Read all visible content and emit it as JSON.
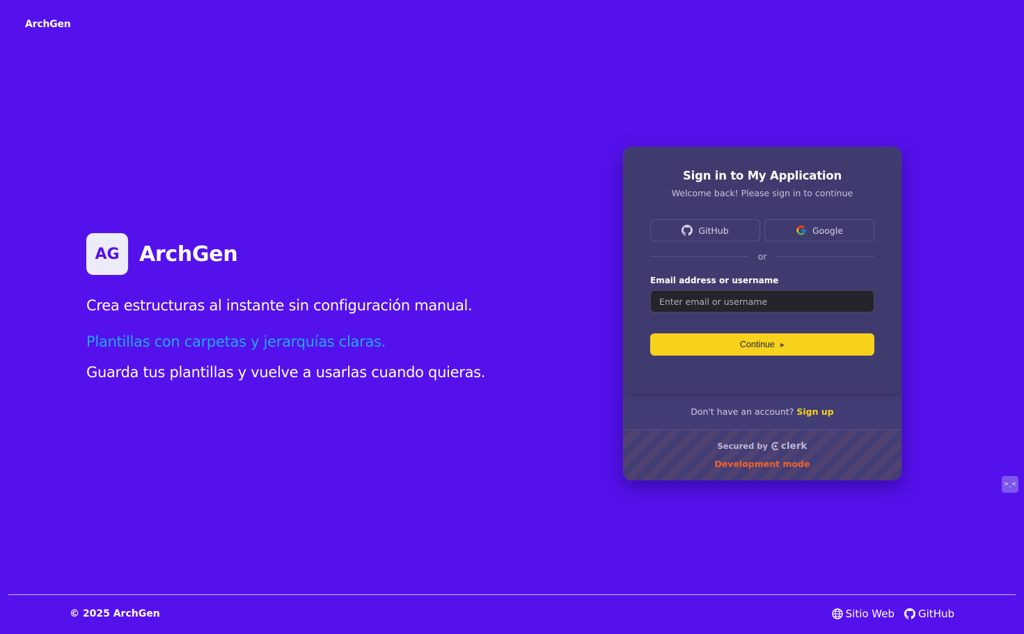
{
  "top_bar": {
    "brand": "ArchGen"
  },
  "hero": {
    "logo_initials": "AG",
    "name": "ArchGen",
    "lines": [
      "Crea estructuras al instante sin configuración manual.",
      "Plantillas con carpetas y jerarquías claras.",
      "Guarda tus plantillas y vuelve a usarlas cuando quieras."
    ],
    "highlight_color": "#1fa9f3"
  },
  "signin": {
    "title": "Sign in to My Application",
    "subtitle": "Welcome back! Please sign in to continue",
    "social": [
      {
        "label": "GitHub",
        "icon": "github-icon"
      },
      {
        "label": "Google",
        "icon": "google-icon"
      }
    ],
    "divider": "or",
    "email_label": "Email address or username",
    "email_placeholder": "Enter email or username",
    "email_value": "",
    "continue_label": "Continue",
    "signup_prompt": "Don't have an account?",
    "signup_link": "Sign up",
    "secured_by": "Secured by",
    "clerk_brand": "clerk",
    "dev_mode": "Development mode",
    "accent_color": "#f6d21d"
  },
  "footer": {
    "copyright": "© 2025 ArchGen",
    "links": [
      {
        "label": "Sitio Web",
        "icon": "globe-icon"
      },
      {
        "label": "GitHub",
        "icon": "github-icon"
      }
    ]
  },
  "widget": {
    "glyph": ">_<"
  },
  "colors": {
    "background": "#5511ec",
    "card": "#403b6f",
    "dev_mode": "#f0652a"
  }
}
